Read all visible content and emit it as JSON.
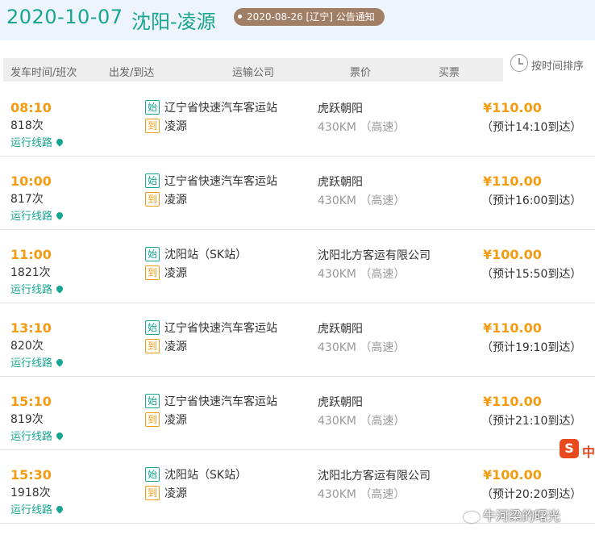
{
  "header": {
    "date": "2020-10-07",
    "route": "沈阳-凌源",
    "notice": "2020-08-26 [辽宁] 公告通知"
  },
  "table_header": {
    "col_time": "发车时间/班次",
    "col_stations": "出发/到达",
    "col_company": "运输公司",
    "col_price": "票价",
    "col_buy": "买票"
  },
  "sort": {
    "label": "按时间排序"
  },
  "labels": {
    "route_link": "运行线路",
    "start_tag": "始",
    "end_tag": "到"
  },
  "rows": [
    {
      "time": "08:10",
      "code": "818次",
      "from": "辽宁省快速汽车客运站",
      "to": "凌源",
      "company": "虎跃朝阳",
      "distance": "430KM （高速）",
      "price": "¥110.00",
      "arrive": "（预计14:10到达）"
    },
    {
      "time": "10:00",
      "code": "817次",
      "from": "辽宁省快速汽车客运站",
      "to": "凌源",
      "company": "虎跃朝阳",
      "distance": "430KM （高速）",
      "price": "¥110.00",
      "arrive": "（预计16:00到达）"
    },
    {
      "time": "11:00",
      "code": "1821次",
      "from": "沈阳站（SK站）",
      "to": "凌源",
      "company": "沈阳北方客运有限公司",
      "distance": "430KM （高速）",
      "price": "¥100.00",
      "arrive": "（预计15:50到达）"
    },
    {
      "time": "13:10",
      "code": "820次",
      "from": "辽宁省快速汽车客运站",
      "to": "凌源",
      "company": "虎跃朝阳",
      "distance": "430KM （高速）",
      "price": "¥110.00",
      "arrive": "（预计19:10到达）"
    },
    {
      "time": "15:10",
      "code": "819次",
      "from": "辽宁省快速汽车客运站",
      "to": "凌源",
      "company": "虎跃朝阳",
      "distance": "430KM （高速）",
      "price": "¥110.00",
      "arrive": "（预计21:10到达）"
    },
    {
      "time": "15:30",
      "code": "1918次",
      "from": "沈阳站（SK站）",
      "to": "凌源",
      "company": "沈阳北方客运有限公司",
      "distance": "430KM （高速）",
      "price": "¥100.00",
      "arrive": "（预计20:20到达）"
    }
  ],
  "overlay": {
    "ime_logo": "S",
    "ime_lang": "中",
    "watermark": "牛河梁的曙光"
  },
  "colors": {
    "accent_teal": "#16a590",
    "accent_orange": "#f39c12",
    "notice_brown": "#a17e66"
  }
}
